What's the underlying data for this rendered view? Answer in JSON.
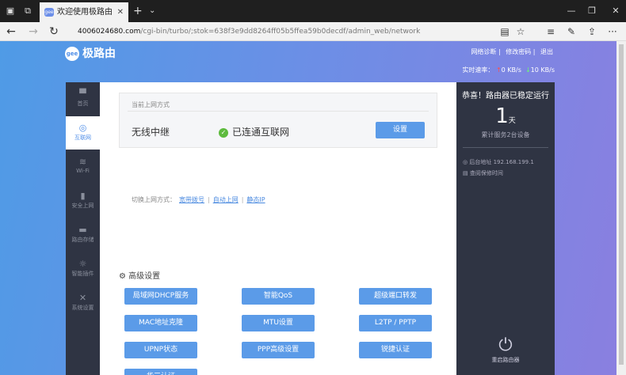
{
  "browser": {
    "tab_title": "欢迎使用极路由",
    "favicon_text": "gee",
    "url_host": "4006024680.com",
    "url_path": "/cgi-bin/turbo/;stok=638f3e9dd8264ff05b5ffea59b0decdf/admin_web/network"
  },
  "header": {
    "logo_text": "极路由",
    "logo_mark": "gee",
    "links": [
      "网络诊断",
      "修改密码",
      "退出"
    ],
    "speed_label": "实时速率：",
    "up_value": "0 KB/s",
    "down_value": "10 KB/s"
  },
  "sidebar": {
    "items": [
      {
        "label": "首页",
        "icon": "home-icon"
      },
      {
        "label": "互联网",
        "icon": "globe-icon"
      },
      {
        "label": "Wi-Fi",
        "icon": "wifi-icon"
      },
      {
        "label": "安全上网",
        "icon": "lock-icon"
      },
      {
        "label": "路由存储",
        "icon": "folder-icon"
      },
      {
        "label": "智能插件",
        "icon": "plugin-icon"
      },
      {
        "label": "系统设置",
        "icon": "wrench-icon"
      }
    ]
  },
  "network": {
    "box_title": "当前上网方式",
    "mode": "无线中继",
    "status": "已连通互联网",
    "set_button": "设置",
    "switch_label": "切换上网方式：",
    "switch_options": [
      "宽带拨号",
      "自动上网",
      "静态IP"
    ]
  },
  "advanced": {
    "title": "高级设置",
    "buttons": [
      "局域网DHCP服务",
      "智能QoS",
      "超级端口转发",
      "MAC地址克隆",
      "MTU设置",
      "L2TP / PPTP",
      "UPNP状态",
      "PPP高级设置",
      "锐捷认证",
      "华三认证"
    ]
  },
  "panel": {
    "title": "恭喜！路由器已稳定运行",
    "days": "1",
    "days_unit": "天",
    "served": "累计服务2台设备",
    "admin_label": "后台地址",
    "admin_ip": "192.168.199.1",
    "warranty": "查阅保修时间",
    "reboot": "重启路由器"
  }
}
